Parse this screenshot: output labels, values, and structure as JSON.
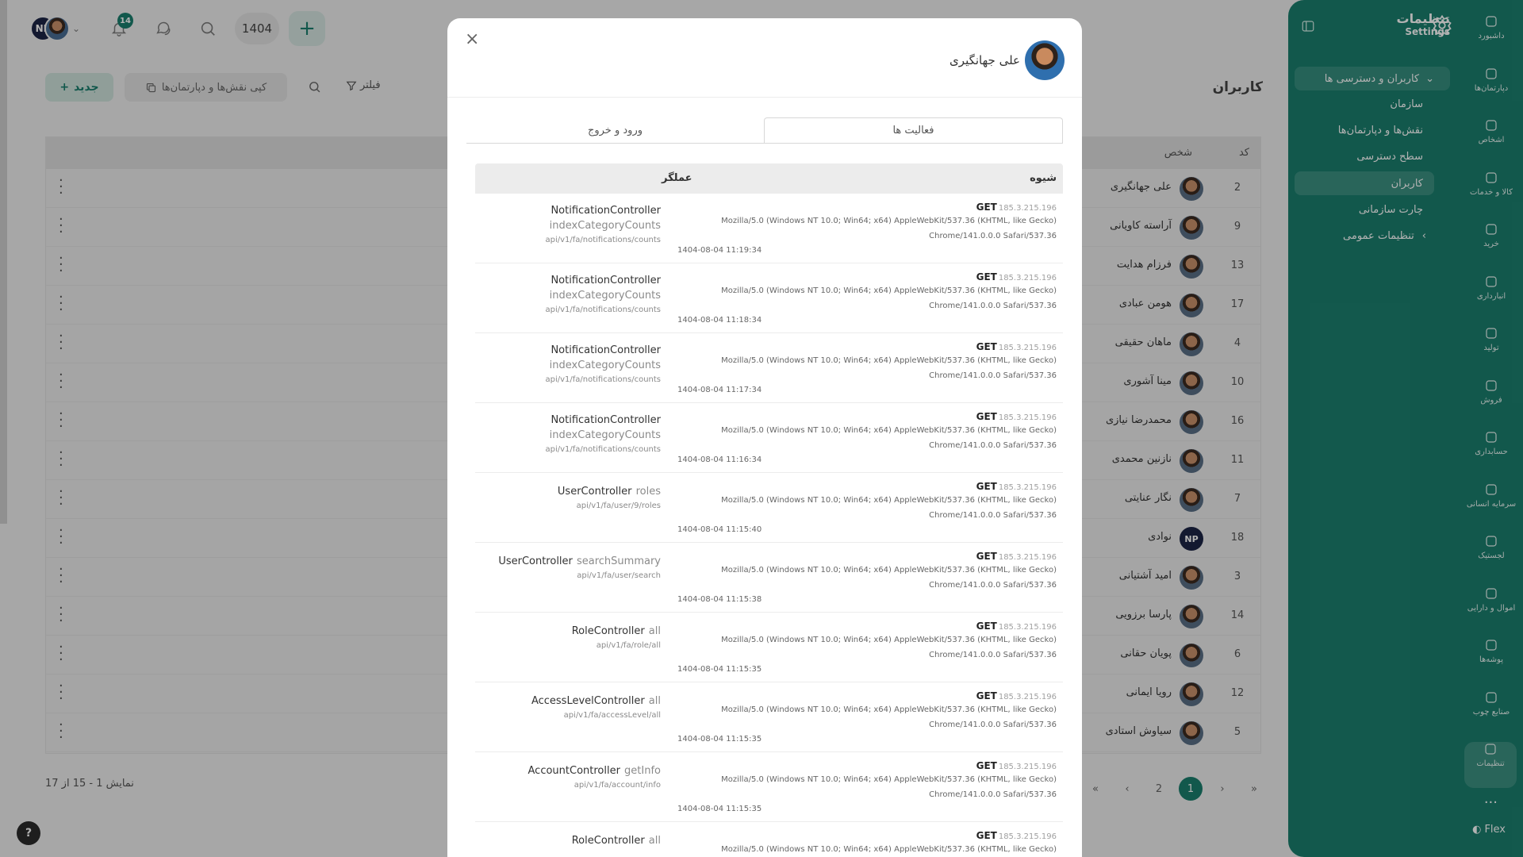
{
  "topbar": {
    "avatar_initials": "NP",
    "notification_count": "14",
    "year": "1404"
  },
  "main": {
    "title": "کاربران",
    "new_button": "جدید",
    "copy_button": "کپی نقش‌ها و دپارتمان‌ها",
    "filter_button": "فیلتر",
    "columns": {
      "code": "کد",
      "person": "شخص"
    },
    "rows": [
      {
        "code": "2",
        "name": "علی جهانگیری"
      },
      {
        "code": "9",
        "name": "آراسته کاویانی"
      },
      {
        "code": "13",
        "name": "فرزام هدایت"
      },
      {
        "code": "17",
        "name": "هومن عبادی"
      },
      {
        "code": "4",
        "name": "ماهان حقیقی"
      },
      {
        "code": "10",
        "name": "مینا آشوری"
      },
      {
        "code": "16",
        "name": "محمدرضا نیازی"
      },
      {
        "code": "11",
        "name": "نازنین محمدی"
      },
      {
        "code": "7",
        "name": "نگار عنایتی"
      },
      {
        "code": "18",
        "name": "نوادی"
      },
      {
        "code": "3",
        "name": "امید آشتیانی"
      },
      {
        "code": "14",
        "name": "پارسا برزویی"
      },
      {
        "code": "6",
        "name": "پویان حقانی"
      },
      {
        "code": "12",
        "name": "رویا ایمانی"
      },
      {
        "code": "5",
        "name": "سیاوش استادی"
      }
    ],
    "row_avatar_np": "NP",
    "showing": "نمایش 1 - 15 از 17",
    "pages": [
      "1",
      "2"
    ]
  },
  "sidebar": {
    "title": "تنظیمات",
    "subtitle": "Settings",
    "group": "کاربران و دسترسی ها",
    "subitems": [
      "سازمان",
      "نقش‌ها و دپارتمان‌ها",
      "سطح دسترسی",
      "کاربران",
      "چارت سازمانی"
    ],
    "general": "تنظیمات عمومی",
    "rail": [
      "داشبورد",
      "دپارتمان‌ها",
      "اشخاص",
      "کالا و خدمات",
      "خرید",
      "انبارداری",
      "تولید",
      "فروش",
      "حسابداری",
      "سرمایه انسانی",
      "لجستیک",
      "اموال و دارایی",
      "پوشه‌ها",
      "صنایع چوب",
      "تنظیمات"
    ],
    "more": "...",
    "brand": "Flex"
  },
  "modal": {
    "user_name": "علی جهانگیری",
    "tabs": [
      "فعالیت ها",
      "ورود و خروج"
    ],
    "columns": {
      "method": "شیوه",
      "actor": "عملگر"
    },
    "ua_line1": "Mozilla/5.0 (Windows NT 10.0; Win64; x64) AppleWebKit/537.36 (KHTML, like Gecko)",
    "ua_line2": "Chrome/141.0.0.0 Safari/537.36",
    "activities": [
      {
        "method": "GET",
        "ip": "185.3.215.196",
        "controller": "NotificationController",
        "action": "indexCategoryCounts",
        "path": "api/v1/fa/notifications/counts",
        "time": "1404-08-04 11:19:34",
        "wrap": true
      },
      {
        "method": "GET",
        "ip": "185.3.215.196",
        "controller": "NotificationController",
        "action": "indexCategoryCounts",
        "path": "api/v1/fa/notifications/counts",
        "time": "1404-08-04 11:18:34",
        "wrap": true
      },
      {
        "method": "GET",
        "ip": "185.3.215.196",
        "controller": "NotificationController",
        "action": "indexCategoryCounts",
        "path": "api/v1/fa/notifications/counts",
        "time": "1404-08-04 11:17:34",
        "wrap": true
      },
      {
        "method": "GET",
        "ip": "185.3.215.196",
        "controller": "NotificationController",
        "action": "indexCategoryCounts",
        "path": "api/v1/fa/notifications/counts",
        "time": "1404-08-04 11:16:34",
        "wrap": true
      },
      {
        "method": "GET",
        "ip": "185.3.215.196",
        "controller": "UserController",
        "action": "roles",
        "path": "api/v1/fa/user/9/roles",
        "time": "1404-08-04 11:15:40",
        "wrap": false
      },
      {
        "method": "GET",
        "ip": "185.3.215.196",
        "controller": "UserController",
        "action": "searchSummary",
        "path": "api/v1/fa/user/search",
        "time": "1404-08-04 11:15:38",
        "wrap": false
      },
      {
        "method": "GET",
        "ip": "185.3.215.196",
        "controller": "RoleController",
        "action": "all",
        "path": "api/v1/fa/role/all",
        "time": "1404-08-04 11:15:35",
        "wrap": false
      },
      {
        "method": "GET",
        "ip": "185.3.215.196",
        "controller": "AccessLevelController",
        "action": "all",
        "path": "api/v1/fa/accessLevel/all",
        "time": "1404-08-04 11:15:35",
        "wrap": false
      },
      {
        "method": "GET",
        "ip": "185.3.215.196",
        "controller": "AccountController",
        "action": "getInfo",
        "path": "api/v1/fa/account/info",
        "time": "1404-08-04 11:15:35",
        "wrap": false
      },
      {
        "method": "GET",
        "ip": "185.3.215.196",
        "controller": "RoleController",
        "action": "all",
        "path": "",
        "time": "",
        "wrap": false
      }
    ]
  }
}
